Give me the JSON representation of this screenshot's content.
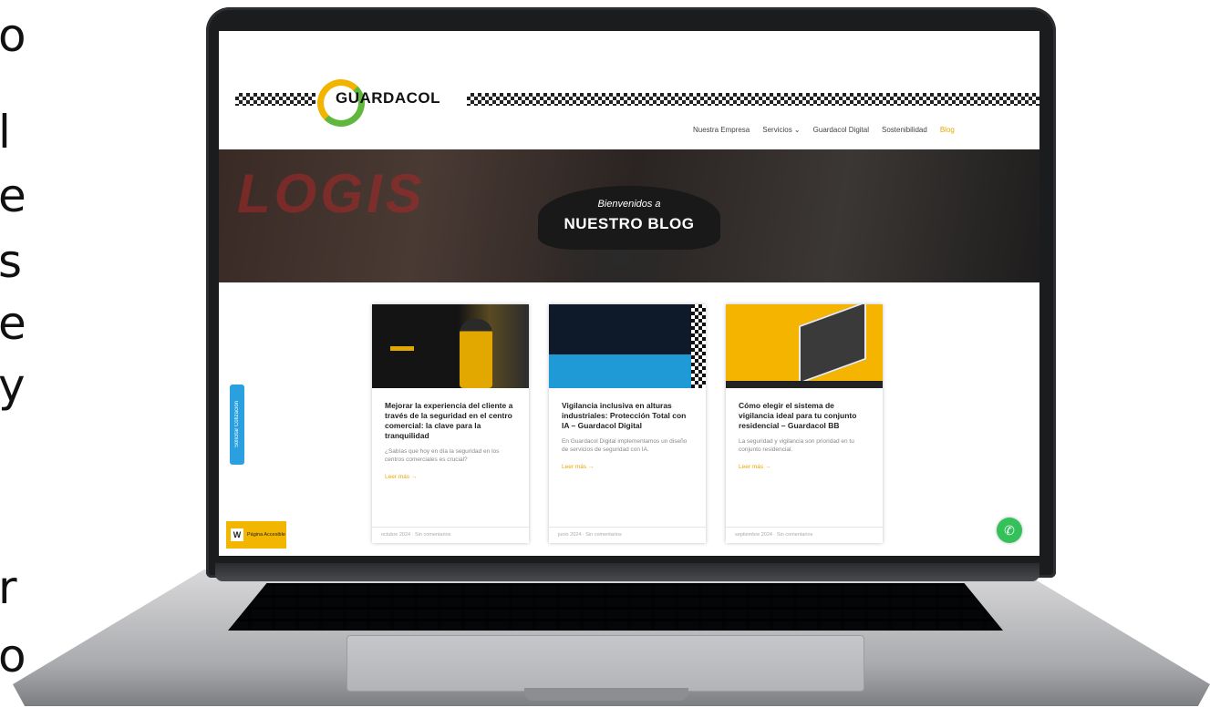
{
  "edge_text": [
    "o",
    "l",
    "e",
    "s",
    "e",
    "y",
    "r",
    "o"
  ],
  "header": {
    "logo_text": "GUARDACOL",
    "nav": [
      {
        "label": "Nuestra Empresa",
        "active": false
      },
      {
        "label": "Servicios ⌄",
        "active": false
      },
      {
        "label": "Guardacol Digital",
        "active": false
      },
      {
        "label": "Sostenibilidad",
        "active": false
      },
      {
        "label": "Blog",
        "active": true
      }
    ]
  },
  "hero": {
    "subtitle": "Bienvenidos a",
    "title": "NUESTRO BLOG",
    "background_word": "LOGIS"
  },
  "posts": [
    {
      "title": "Mejorar la experiencia del cliente a través de la seguridad en el centro comercial: la clave para la tranquilidad",
      "excerpt": "¿Sabías que hoy en día la seguridad en los centros comerciales es crucial?",
      "more": "Leer más →",
      "meta": "octubre 2024 · Sin comentarios"
    },
    {
      "title": "Vigilancia inclusiva en alturas industriales: Protección Total con IA – Guardacol Digital",
      "excerpt": "En Guardacol Digital implementamos un diseño de servicios de seguridad con IA.",
      "more": "Leer más →",
      "meta": "junio 2024 · Sin comentarios"
    },
    {
      "title": "Cómo elegir el sistema de vigilancia ideal para tu conjunto residencial – Guardacol BB",
      "excerpt": "La seguridad y vigilancia son prioridad en tu conjunto residencial.",
      "more": "Leer más →",
      "meta": "septiembre 2024 · Sin comentarios"
    }
  ],
  "side_tab": {
    "label": "Solicitar Cotización"
  },
  "badge": {
    "icon": "W",
    "text": "Página Accesible"
  },
  "colors": {
    "accent": "#f2b600",
    "whatsapp": "#35c15a",
    "side_tab": "#2aa0e0"
  }
}
